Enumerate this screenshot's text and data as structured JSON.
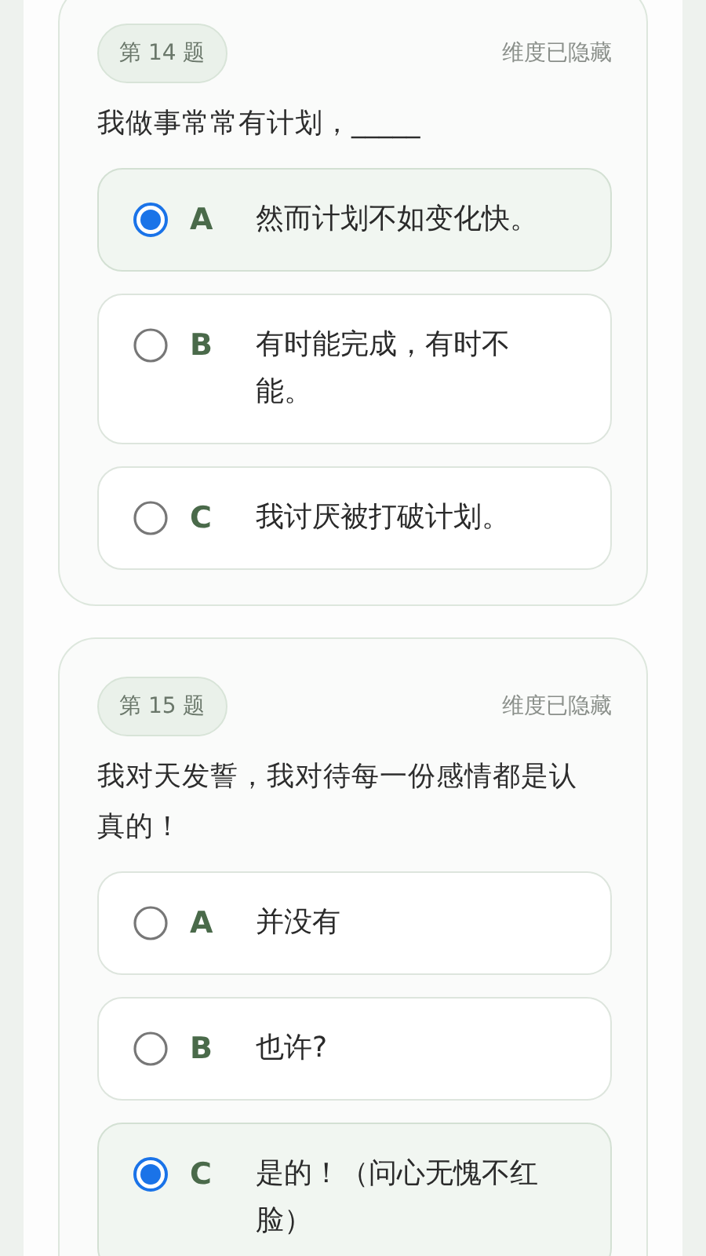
{
  "questions": [
    {
      "number": "第 14 题",
      "dimension": "维度已隐藏",
      "text": "我做事常常有计划，_____",
      "options": [
        {
          "letter": "A",
          "text": "然而计划不如变化快。",
          "selected": true
        },
        {
          "letter": "B",
          "text": "有时能完成，有时不能。",
          "selected": false
        },
        {
          "letter": "C",
          "text": "我讨厌被打破计划。",
          "selected": false
        }
      ]
    },
    {
      "number": "第 15 题",
      "dimension": "维度已隐藏",
      "text": "我对天发誓，我对待每一份感情都是认真的！",
      "options": [
        {
          "letter": "A",
          "text": "并没有",
          "selected": false
        },
        {
          "letter": "B",
          "text": "也许?",
          "selected": false
        },
        {
          "letter": "C",
          "text": "是的！（问心无愧不红脸）",
          "selected": true
        }
      ]
    }
  ]
}
